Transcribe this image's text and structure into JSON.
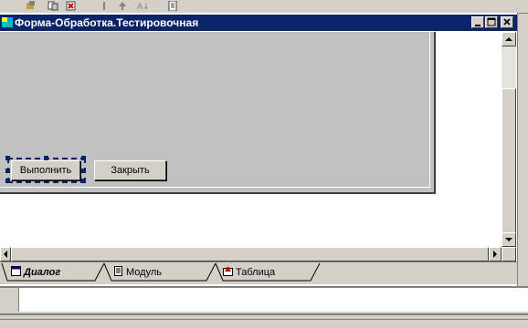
{
  "window": {
    "title": "Форма-Обработка.Тестировочная"
  },
  "form": {
    "run_button_label": "Выполнить",
    "close_button_label": "Закрыть"
  },
  "tabs": [
    {
      "label": "Диалог",
      "icon": "dialog-icon",
      "active": true
    },
    {
      "label": "Модуль",
      "icon": "module-icon",
      "active": false
    },
    {
      "label": "Таблица",
      "icon": "table-icon",
      "active": false
    }
  ],
  "colors": {
    "title_bar": "#0a246a",
    "form_surface": "#c0c0c0",
    "chrome": "#d4d0c8"
  }
}
